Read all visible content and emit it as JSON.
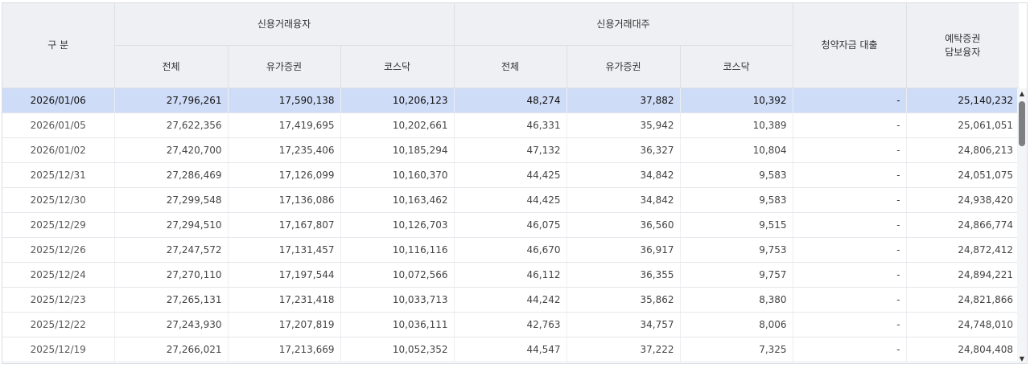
{
  "header": {
    "division": "구 분",
    "group_users": "신용거래융자",
    "group_loans": "신용거래대주",
    "subscription_loan": "청약자금 대출",
    "deposit_loan_line1": "예탁증권",
    "deposit_loan_line2": "담보융자",
    "sub_total": "전체",
    "sub_kospi": "유가증권",
    "sub_kosdaq": "코스닥"
  },
  "rows": [
    {
      "date": "2026/01/06",
      "u_total": "27,796,261",
      "u_kospi": "17,590,138",
      "u_kosdaq": "10,206,123",
      "l_total": "48,274",
      "l_kospi": "37,882",
      "l_kosdaq": "10,392",
      "sub": "-",
      "deposit": "25,140,232"
    },
    {
      "date": "2026/01/05",
      "u_total": "27,622,356",
      "u_kospi": "17,419,695",
      "u_kosdaq": "10,202,661",
      "l_total": "46,331",
      "l_kospi": "35,942",
      "l_kosdaq": "10,389",
      "sub": "-",
      "deposit": "25,061,051"
    },
    {
      "date": "2026/01/02",
      "u_total": "27,420,700",
      "u_kospi": "17,235,406",
      "u_kosdaq": "10,185,294",
      "l_total": "47,132",
      "l_kospi": "36,327",
      "l_kosdaq": "10,804",
      "sub": "-",
      "deposit": "24,806,213"
    },
    {
      "date": "2025/12/31",
      "u_total": "27,286,469",
      "u_kospi": "17,126,099",
      "u_kosdaq": "10,160,370",
      "l_total": "44,425",
      "l_kospi": "34,842",
      "l_kosdaq": "9,583",
      "sub": "-",
      "deposit": "24,051,075"
    },
    {
      "date": "2025/12/30",
      "u_total": "27,299,548",
      "u_kospi": "17,136,086",
      "u_kosdaq": "10,163,462",
      "l_total": "44,425",
      "l_kospi": "34,842",
      "l_kosdaq": "9,583",
      "sub": "-",
      "deposit": "24,938,420"
    },
    {
      "date": "2025/12/29",
      "u_total": "27,294,510",
      "u_kospi": "17,167,807",
      "u_kosdaq": "10,126,703",
      "l_total": "46,075",
      "l_kospi": "36,560",
      "l_kosdaq": "9,515",
      "sub": "-",
      "deposit": "24,866,774"
    },
    {
      "date": "2025/12/26",
      "u_total": "27,247,572",
      "u_kospi": "17,131,457",
      "u_kosdaq": "10,116,116",
      "l_total": "46,670",
      "l_kospi": "36,917",
      "l_kosdaq": "9,753",
      "sub": "-",
      "deposit": "24,872,412"
    },
    {
      "date": "2025/12/24",
      "u_total": "27,270,110",
      "u_kospi": "17,197,544",
      "u_kosdaq": "10,072,566",
      "l_total": "46,112",
      "l_kospi": "36,355",
      "l_kosdaq": "9,757",
      "sub": "-",
      "deposit": "24,894,221"
    },
    {
      "date": "2025/12/23",
      "u_total": "27,265,131",
      "u_kospi": "17,231,418",
      "u_kosdaq": "10,033,713",
      "l_total": "44,242",
      "l_kospi": "35,862",
      "l_kosdaq": "8,380",
      "sub": "-",
      "deposit": "24,821,866"
    },
    {
      "date": "2025/12/22",
      "u_total": "27,243,930",
      "u_kospi": "17,207,819",
      "u_kosdaq": "10,036,111",
      "l_total": "42,763",
      "l_kospi": "34,757",
      "l_kosdaq": "8,006",
      "sub": "-",
      "deposit": "24,748,010"
    },
    {
      "date": "2025/12/19",
      "u_total": "27,266,021",
      "u_kospi": "17,213,669",
      "u_kosdaq": "10,052,352",
      "l_total": "44,547",
      "l_kospi": "37,222",
      "l_kosdaq": "7,325",
      "sub": "-",
      "deposit": "24,804,408"
    }
  ],
  "selected_row": 0,
  "colors": {
    "selected_row": "#cfdcf7",
    "header_bg": "#eef0f3",
    "scroll_thumb": "#7d7f83"
  },
  "icons": {
    "scroll_up": "scroll-up-arrow-icon",
    "scroll_down": "scroll-down-arrow-icon"
  }
}
